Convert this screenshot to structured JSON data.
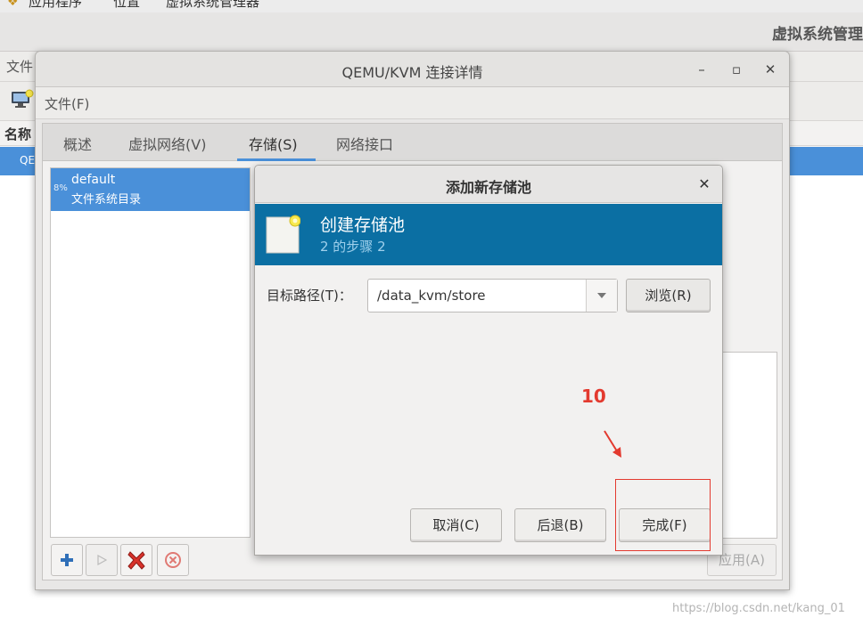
{
  "top_panel": {
    "applications": "应用程序",
    "places": "位置",
    "app_name": "虚拟系统管理器"
  },
  "background_window": {
    "title": "虚拟系统管理",
    "menu_file": "文件",
    "column_name": "名称",
    "selected_row_label": "QE"
  },
  "connection_window": {
    "title": "QEMU/KVM 连接详情",
    "menu_file": "文件(F)",
    "tabs": [
      {
        "label": "概述"
      },
      {
        "label": "虚拟网络(V)"
      },
      {
        "label": "存储(S)"
      },
      {
        "label": "网络接口"
      }
    ],
    "active_tab": "存储(S)",
    "pool": {
      "usage": "8%",
      "name": "default",
      "type": "文件系统目录"
    },
    "apply_label": "应用(A)"
  },
  "dialog": {
    "title": "添加新存储池",
    "header_title": "创建存储池",
    "step_text": "2 的步骤 2",
    "target_label": "目标路径(T)：",
    "target_value": "/data_kvm/store",
    "browse_label": "浏览(R)",
    "buttons": {
      "cancel": "取消(C)",
      "back": "后退(B)",
      "finish": "完成(F)"
    }
  },
  "annotation": {
    "number": "10",
    "color": "#e33a2f"
  },
  "watermark": "https://blog.csdn.net/kang_01",
  "colors": {
    "accent": "#4a90d9",
    "dialog_header": "#0b6fa3"
  }
}
